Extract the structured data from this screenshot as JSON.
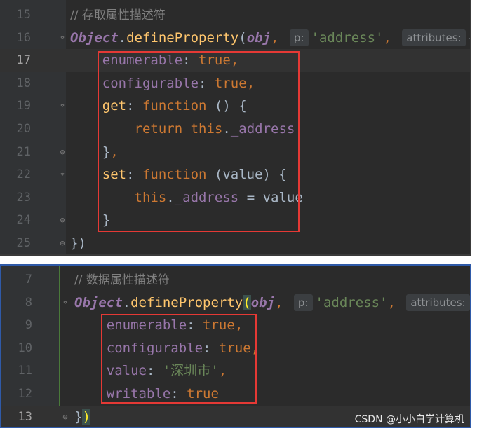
{
  "panel_a": {
    "lines": [
      {
        "n": "15",
        "tokens": [
          {
            "t": "// 存取属性描述符",
            "c": "cm"
          }
        ]
      },
      {
        "n": "16",
        "tokens": [
          {
            "t": "Object",
            "c": "obj"
          },
          {
            "t": ".",
            "c": "plain"
          },
          {
            "t": "defineProperty",
            "c": "fn"
          },
          {
            "t": "(",
            "c": "plain"
          },
          {
            "t": "obj",
            "c": "obj"
          },
          {
            "t": ", ",
            "c": "kw"
          },
          {
            "t": "p:",
            "c": "hint"
          },
          {
            "t": "'address'",
            "c": "str"
          },
          {
            "t": ", ",
            "c": "kw"
          },
          {
            "t": "attributes:",
            "c": "hint"
          },
          {
            "t": "{",
            "c": "plain"
          }
        ]
      },
      {
        "n": "17",
        "current": true,
        "tokens": [
          {
            "t": "    enumerable",
            "c": "prop"
          },
          {
            "t": ": ",
            "c": "plain"
          },
          {
            "t": "true",
            "c": "kw"
          },
          {
            "t": ",",
            "c": "kw"
          }
        ]
      },
      {
        "n": "18",
        "tokens": [
          {
            "t": "    configurable",
            "c": "prop"
          },
          {
            "t": ": ",
            "c": "plain"
          },
          {
            "t": "true",
            "c": "kw"
          },
          {
            "t": ",",
            "c": "kw"
          }
        ]
      },
      {
        "n": "19",
        "tokens": [
          {
            "t": "    get",
            "c": "fn"
          },
          {
            "t": ": ",
            "c": "plain"
          },
          {
            "t": "function",
            "c": "kw"
          },
          {
            "t": " () {",
            "c": "plain"
          }
        ]
      },
      {
        "n": "20",
        "tokens": [
          {
            "t": "        return",
            "c": "kw"
          },
          {
            "t": " ",
            "c": "plain"
          },
          {
            "t": "this",
            "c": "kw"
          },
          {
            "t": ".",
            "c": "plain"
          },
          {
            "t": "_address",
            "c": "prop"
          }
        ]
      },
      {
        "n": "21",
        "tokens": [
          {
            "t": "    }",
            "c": "plain"
          },
          {
            "t": ",",
            "c": "kw"
          }
        ]
      },
      {
        "n": "22",
        "tokens": [
          {
            "t": "    set",
            "c": "fn"
          },
          {
            "t": ": ",
            "c": "plain"
          },
          {
            "t": "function",
            "c": "kw"
          },
          {
            "t": " (value) {",
            "c": "plain"
          }
        ]
      },
      {
        "n": "23",
        "tokens": [
          {
            "t": "        this",
            "c": "kw"
          },
          {
            "t": ".",
            "c": "plain"
          },
          {
            "t": "_address",
            "c": "prop"
          },
          {
            "t": " = value",
            "c": "plain"
          }
        ]
      },
      {
        "n": "24",
        "tokens": [
          {
            "t": "    }",
            "c": "plain"
          }
        ]
      },
      {
        "n": "25",
        "tokens": [
          {
            "t": "})",
            "c": "plain"
          }
        ]
      }
    ]
  },
  "panel_b": {
    "lines": [
      {
        "n": "7",
        "tokens": [
          {
            "t": "// 数据属性描述符",
            "c": "cm"
          }
        ]
      },
      {
        "n": "8",
        "tokens": [
          {
            "t": "Object",
            "c": "obj"
          },
          {
            "t": ".",
            "c": "plain"
          },
          {
            "t": "defineProperty",
            "c": "fn"
          },
          {
            "t": "(",
            "c": "brace-hl"
          },
          {
            "t": "obj",
            "c": "obj"
          },
          {
            "t": ", ",
            "c": "kw"
          },
          {
            "t": "p:",
            "c": "hint"
          },
          {
            "t": "'address'",
            "c": "str"
          },
          {
            "t": ", ",
            "c": "kw"
          },
          {
            "t": "attributes:",
            "c": "hint"
          },
          {
            "t": "{",
            "c": "plain"
          }
        ]
      },
      {
        "n": "9",
        "tokens": [
          {
            "t": "    enumerable",
            "c": "prop"
          },
          {
            "t": ": ",
            "c": "plain"
          },
          {
            "t": "true",
            "c": "kw"
          },
          {
            "t": ",",
            "c": "kw"
          }
        ]
      },
      {
        "n": "10",
        "tokens": [
          {
            "t": "    configurable",
            "c": "prop"
          },
          {
            "t": ": ",
            "c": "plain"
          },
          {
            "t": "true",
            "c": "kw"
          },
          {
            "t": ",",
            "c": "kw"
          }
        ]
      },
      {
        "n": "11",
        "tokens": [
          {
            "t": "    value",
            "c": "prop"
          },
          {
            "t": ": ",
            "c": "plain"
          },
          {
            "t": "'深圳市'",
            "c": "str"
          },
          {
            "t": ",",
            "c": "kw"
          }
        ]
      },
      {
        "n": "12",
        "tokens": [
          {
            "t": "    writable",
            "c": "prop"
          },
          {
            "t": ": ",
            "c": "plain"
          },
          {
            "t": "true",
            "c": "kw"
          }
        ]
      },
      {
        "n": "13",
        "current": true,
        "tokens": [
          {
            "t": "}",
            "c": "plain"
          },
          {
            "t": ")",
            "c": "brace-hl"
          }
        ]
      }
    ]
  },
  "watermark": "CSDN @小小白学计算机",
  "colors": {
    "keyword": "#cc7832",
    "property": "#9876aa",
    "function": "#ffc66d",
    "string": "#6a8759",
    "highlight_box": "#e53935"
  }
}
